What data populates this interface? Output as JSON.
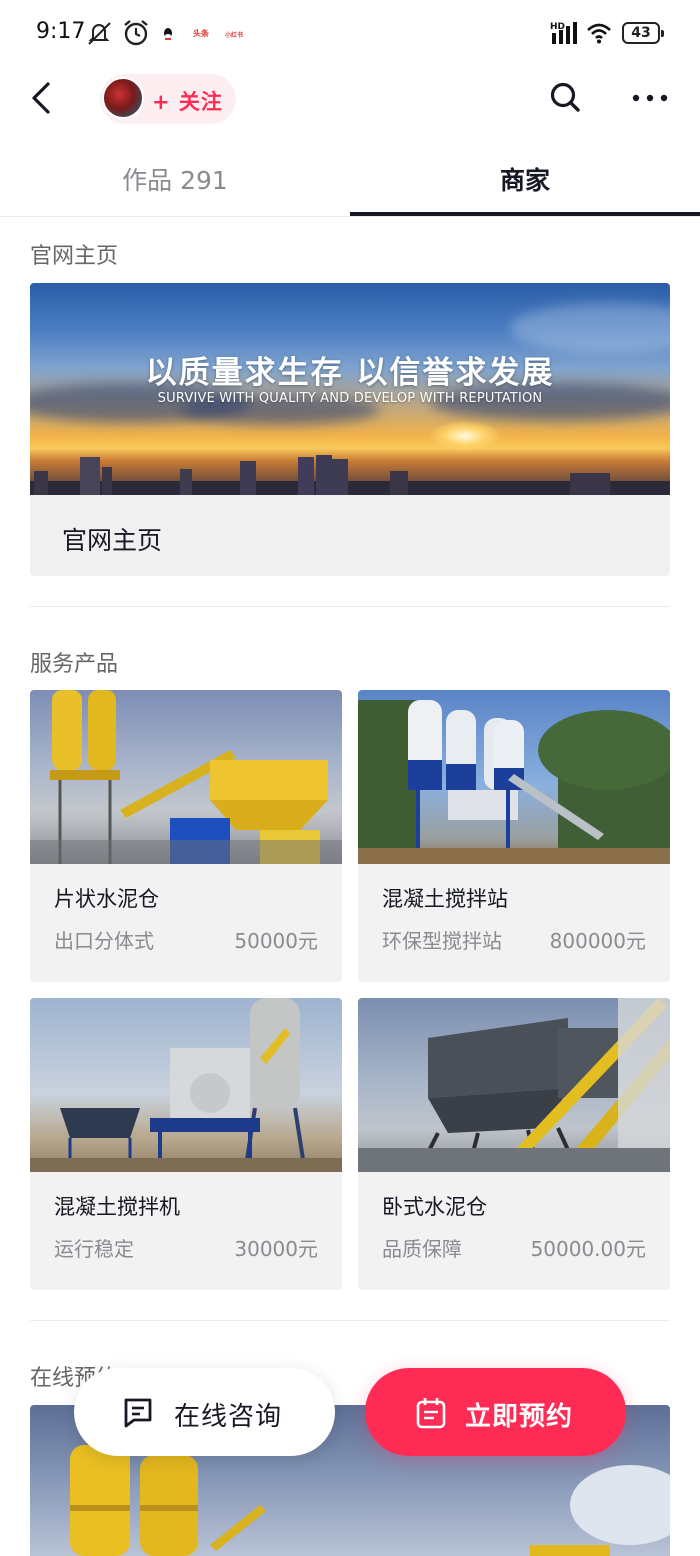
{
  "status_bar": {
    "time": "9:17",
    "notification_apps": [
      "头条",
      "小红书"
    ],
    "battery": "43",
    "icons": [
      "mute-icon",
      "alarm-icon",
      "qq-icon",
      "hd-signal-icon",
      "wifi-icon",
      "battery-icon"
    ]
  },
  "header": {
    "follow_label": "+ 关注",
    "icons": [
      "back-arrow-icon",
      "search-icon",
      "more-icon"
    ]
  },
  "tabs": [
    {
      "label": "作品 291",
      "active": false
    },
    {
      "label": "商家",
      "active": true
    }
  ],
  "website": {
    "section_title": "官网主页",
    "banner_title": "以质量求生存  以信誉求发展",
    "banner_subtitle": "SURVIVE WITH QUALITY AND DEVELOP WITH REPUTATION",
    "card_label": "官网主页"
  },
  "products": {
    "section_title": "服务产品",
    "items": [
      {
        "name": "片状水泥仓",
        "tag": "出口分体式",
        "price": "50000元"
      },
      {
        "name": "混凝土搅拌站",
        "tag": "环保型搅拌站",
        "price": "800000元"
      },
      {
        "name": "混凝土搅拌机",
        "tag": "运行稳定",
        "price": "30000元"
      },
      {
        "name": "卧式水泥仓",
        "tag": "品质保障",
        "price": "50000.00元"
      }
    ]
  },
  "booking": {
    "section_title": "在线预约"
  },
  "actions": {
    "consult_label": "在线咨询",
    "book_label": "立即预约"
  },
  "colors": {
    "accent": "#fe2c55",
    "text_primary": "#161823",
    "text_secondary": "#8a8b91",
    "card_bg": "#f2f2f2"
  }
}
